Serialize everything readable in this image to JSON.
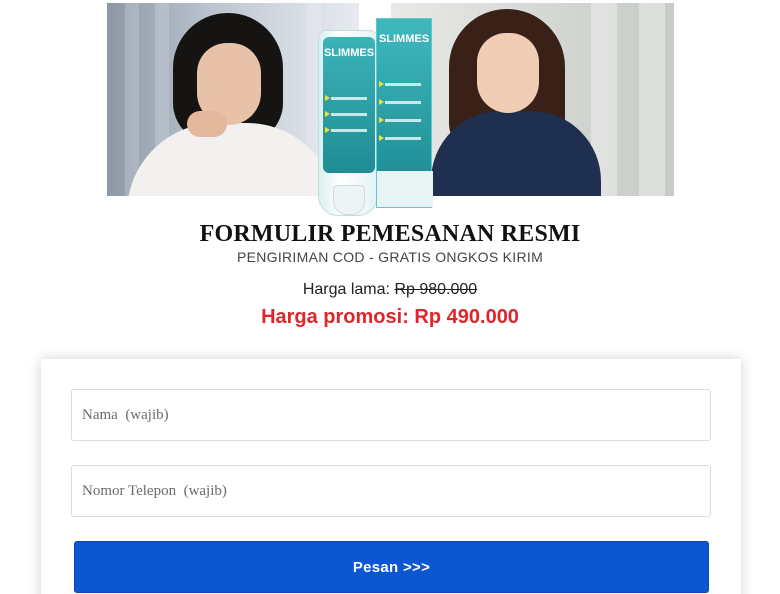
{
  "hero": {
    "product_brand": "SLIMMES"
  },
  "header": {
    "title": "FORMULIR PEMESANAN RESMI",
    "subtitle": "PENGIRIMAN COD - GRATIS ONGKOS KIRIM"
  },
  "pricing": {
    "old_label": "Harga lama:",
    "old_value": "Rp 980.000",
    "promo_label": "Harga promosi: Rp 490.000"
  },
  "form": {
    "name_placeholder": "Nama  (wajib)",
    "phone_placeholder": "Nomor Telepon  (wajib)",
    "submit_label": "Pesan  >>>"
  },
  "colors": {
    "accent_blue": "#0d56d1",
    "promo_red": "#e0262b",
    "product_teal": "#2aa3aa"
  }
}
